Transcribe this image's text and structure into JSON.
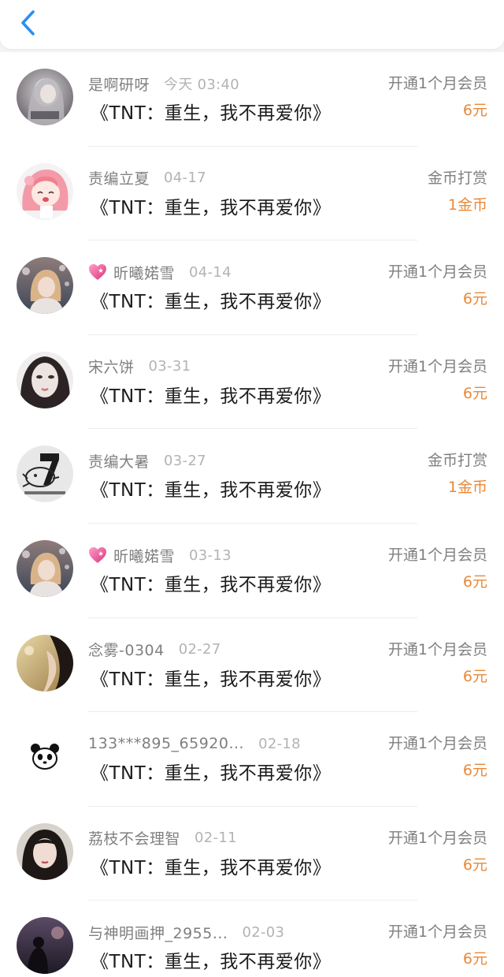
{
  "header": {
    "back_icon": "chevron-left-icon",
    "accent_color": "#2a8ff7"
  },
  "colors": {
    "amount": "#e8893a",
    "name": "#7f7f7f",
    "time": "#b3b3b3",
    "title": "#1c1c1c"
  },
  "records": [
    {
      "avatar": "avatar-gray-hair",
      "heart": false,
      "name": "是啊研呀",
      "time": "今天 03:40",
      "book": "《TNT：重生，我不再爱你》",
      "action": "开通1个月会员",
      "amount": "6元"
    },
    {
      "avatar": "avatar-anime-pink",
      "heart": false,
      "name": "责编立夏",
      "time": "04-17",
      "book": "《TNT：重生，我不再爱你》",
      "action": "金币打赏",
      "amount": "1金币"
    },
    {
      "avatar": "avatar-blonde-girl",
      "heart": true,
      "name": "昕曦婼雪",
      "time": "04-14",
      "book": "《TNT：重生，我不再爱你》",
      "action": "开通1个月会员",
      "amount": "6元"
    },
    {
      "avatar": "avatar-pale-face",
      "heart": false,
      "name": "宋六饼",
      "time": "03-31",
      "book": "《TNT：重生，我不再爱你》",
      "action": "开通1个月会员",
      "amount": "6元"
    },
    {
      "avatar": "avatar-seven-sketch",
      "heart": false,
      "name": "责编大暑",
      "time": "03-27",
      "book": "《TNT：重生，我不再爱你》",
      "action": "金币打赏",
      "amount": "1金币"
    },
    {
      "avatar": "avatar-blonde-girl",
      "heart": true,
      "name": "昕曦婼雪",
      "time": "03-13",
      "book": "《TNT：重生，我不再爱你》",
      "action": "开通1个月会员",
      "amount": "6元"
    },
    {
      "avatar": "avatar-golden-profile",
      "heart": false,
      "name": "念雾-0304",
      "time": "02-27",
      "book": "《TNT：重生，我不再爱你》",
      "action": "开通1个月会员",
      "amount": "6元"
    },
    {
      "avatar": "avatar-panda",
      "heart": false,
      "name": "133***895_65920...",
      "time": "02-18",
      "book": "《TNT：重生，我不再爱你》",
      "action": "开通1个月会员",
      "amount": "6元"
    },
    {
      "avatar": "avatar-dark-hair",
      "heart": false,
      "name": "荔枝不会理智",
      "time": "02-11",
      "book": "《TNT：重生，我不再爱你》",
      "action": "开通1个月会员",
      "amount": "6元"
    },
    {
      "avatar": "avatar-dusk-figure",
      "heart": false,
      "name": "与神明画押_2955...",
      "time": "02-03",
      "book": "《TNT：重生，我不再爱你》",
      "action": "开通1个月会员",
      "amount": "6元"
    }
  ]
}
